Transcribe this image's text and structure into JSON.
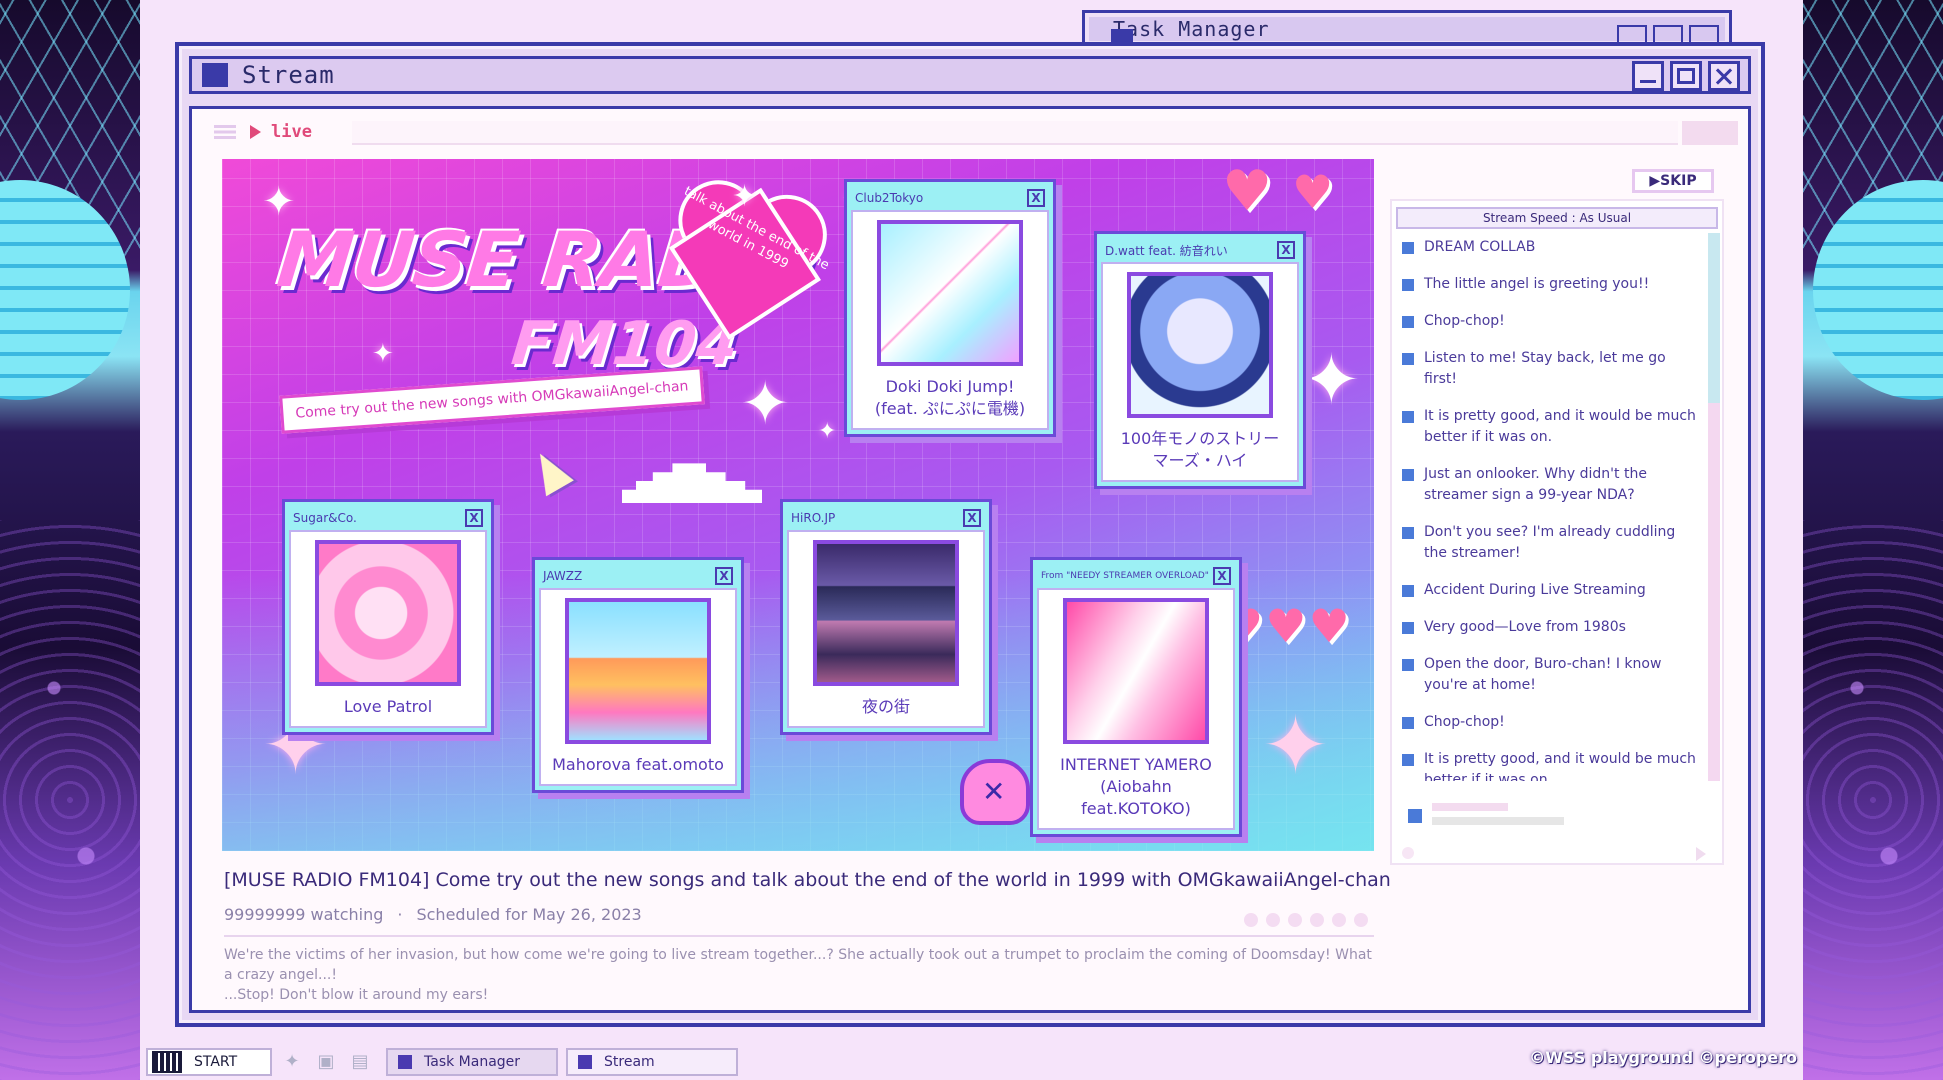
{
  "background_window": {
    "title": "Task Manager"
  },
  "window": {
    "title": "Stream"
  },
  "address": {
    "live_label": "live"
  },
  "hero": {
    "logo_main": "MUSE RADIO",
    "logo_sub": "FM104",
    "heart_text": "talk about the end of the world in 1999",
    "tagline": "Come try out the new songs with OMGkawaiiAngel-chan"
  },
  "cards": [
    {
      "artist": "Club2Tokyo",
      "title_line1": "Doki Doki Jump!",
      "title_line2": "(feat. ぷにぷに電機)",
      "art": "doki"
    },
    {
      "artist": "D.watt feat. 紡音れい",
      "title_line1": "100年モノのストリー",
      "title_line2": "マーズ・ハイ",
      "art": "hyaku"
    },
    {
      "artist": "Sugar&Co.",
      "title_line1": "Love Patrol",
      "title_line2": "",
      "art": "love"
    },
    {
      "artist": "JAWZZ",
      "title_line1": "Mahorova feat.omoto",
      "title_line2": "",
      "art": "maho"
    },
    {
      "artist": "HiRO.JP",
      "title_line1": "夜の街",
      "title_line2": "",
      "art": "yoru"
    },
    {
      "artist": "From \"NEEDY STREAMER OVERLOAD\"",
      "title_line1": "INTERNET YAMERO",
      "title_line2": "(Aiobahn feat.KOTOKO)",
      "art": "inet"
    }
  ],
  "stream": {
    "title": "[MUSE RADIO FM104] Come try out the new songs  and talk about the end of the world in 1999 with OMGkawaiiAngel-chan",
    "watching": "99999999 watching",
    "separator": "·",
    "scheduled": "Scheduled for May 26, 2023",
    "description_line1": "We're the victims of her invasion, but how come we're going to live stream together...? She actually took out a trumpet to proclaim the coming of Doomsday! What a crazy angel...!",
    "description_line2": "...Stop! Don't blow it around my ears!"
  },
  "chat": {
    "skip_label": "▶SKIP",
    "speed_label": "Stream Speed :  As Usual",
    "messages": [
      "DREAM COLLAB",
      "The little angel is greeting you!!",
      "Chop-chop!",
      "Listen to me! Stay back, let me go first!",
      "It is pretty good, and it would be much better if it was on.",
      "Just an onlooker. Why didn't the streamer sign a 99-year NDA?",
      "Don't you see? I'm already cuddling the streamer!",
      "Accident During Live Streaming",
      "Very good—Love from 1980s",
      "Open the door, Buro-chan! I know you're at home!",
      "Chop-chop!",
      "It is pretty good, and it would be much better if it was on."
    ]
  },
  "taskbar": {
    "start_label": "START",
    "task_manager_label": "Task Manager",
    "stream_label": "Stream",
    "copyright": "©WSS playground  ©peropero"
  },
  "colors": {
    "accent": "#3a3aa8",
    "live": "#e04a7a",
    "hero_pink": "#f04ad8",
    "hero_cyan": "#70e0ee"
  },
  "icons": [
    "menu-icon",
    "play-icon",
    "twitter-icon",
    "chat-bubble-icon",
    "monitor-icon",
    "sparkle-icon",
    "heart-icon",
    "cursor-icon",
    "mascot-icon"
  ]
}
